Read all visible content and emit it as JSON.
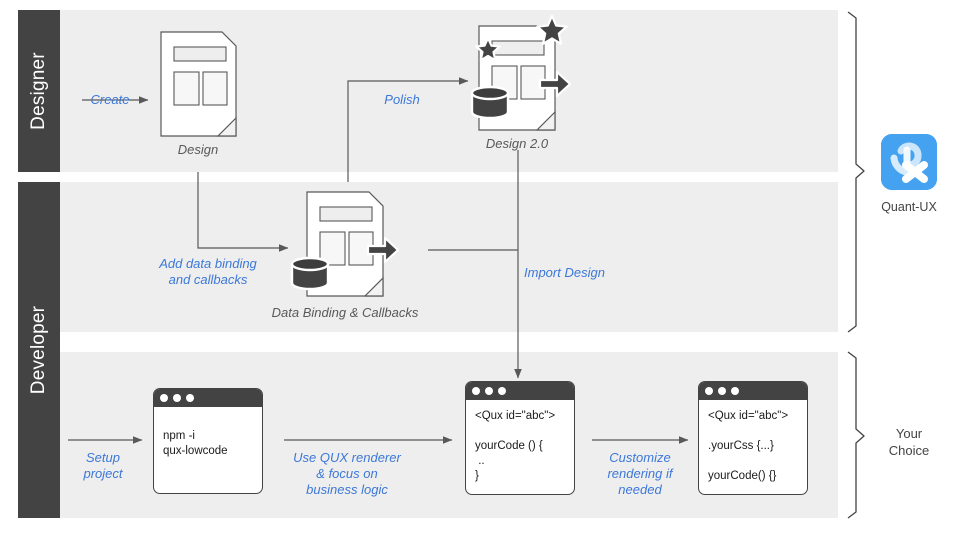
{
  "lanes": [
    {
      "id": "designer",
      "label": "Designer"
    },
    {
      "id": "developer",
      "label": "Developer"
    }
  ],
  "artifacts": {
    "design": {
      "caption": "Design"
    },
    "design2": {
      "caption": "Design 2.0"
    },
    "databinding": {
      "caption": "Data Binding & Callbacks"
    }
  },
  "flow_labels": {
    "create": "Create",
    "polish": "Polish",
    "add_data_binding": "Add data binding\nand callbacks",
    "add_data_binding_line1": "Add data binding",
    "add_data_binding_line2": "and callbacks",
    "import_design": "Import Design",
    "setup_project_line1": "Setup",
    "setup_project_line2": "project",
    "use_qux_line1": "Use QUX renderer",
    "use_qux_line2": "& focus on",
    "use_qux_line3": "business logic",
    "customize_line1": "Customize",
    "customize_line2": "rendering if",
    "customize_line3": "needed"
  },
  "code_windows": [
    {
      "id": "install",
      "lines": [
        "npm -i",
        "qux-lowcode"
      ],
      "text": "npm -i\nqux-lowcode"
    },
    {
      "id": "component",
      "lines": [
        "<Qux id=\"abc\">",
        "",
        "yourCode () {",
        " ..",
        "}"
      ],
      "text": "<Qux id=\"abc\">\n\nyourCode () {\n ..\n}"
    },
    {
      "id": "customized",
      "lines": [
        "<Qux id=\"abc\">",
        "",
        ".yourCss {...}",
        "",
        "yourCode() {}"
      ],
      "text": "<Qux id=\"abc\">\n\n.yourCss {...}\n\nyourCode() {}"
    }
  ],
  "brackets": [
    {
      "id": "quant-ux",
      "label": "Quant-UX",
      "logo_icon": "quant-ux-logo"
    },
    {
      "id": "your-choice",
      "label_line1": "Your",
      "label_line2": "Choice",
      "label": "Your Choice"
    }
  ],
  "colors": {
    "lane_bar": "#434343",
    "panel": "#eeeeee",
    "accent_label": "#3c78d8",
    "caption": "#595959",
    "stroke": "#595959",
    "logo_blue": "#44a2f0",
    "window_bar": "#434343"
  }
}
